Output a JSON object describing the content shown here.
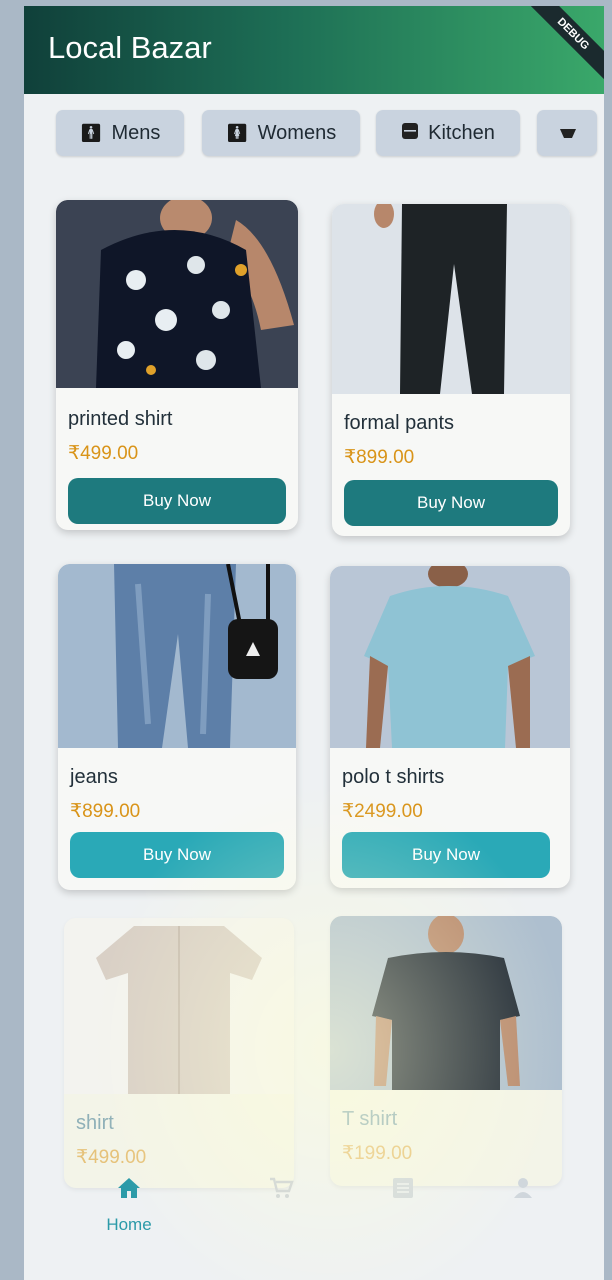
{
  "app": {
    "title": "Local Bazar",
    "debug_banner": "DEBUG"
  },
  "categories": [
    {
      "label": "Mens",
      "icon": "man-icon"
    },
    {
      "label": "Womens",
      "icon": "woman-icon"
    },
    {
      "label": "Kitchen",
      "icon": "kitchen-icon"
    },
    {
      "label": "",
      "icon": "category-icon"
    }
  ],
  "products": [
    {
      "name": "printed shirt",
      "price": "₹499.00",
      "button": "Buy Now"
    },
    {
      "name": "formal pants",
      "price": "₹899.00",
      "button": "Buy Now"
    },
    {
      "name": "jeans",
      "price": "₹899.00",
      "button": "Buy Now"
    },
    {
      "name": "polo t shirts",
      "price": "₹2499.00",
      "button": "Buy Now"
    },
    {
      "name": "shirt",
      "price": "₹499.00"
    },
    {
      "name": "T shirt",
      "price": "₹199.00"
    }
  ],
  "bottom_nav": [
    {
      "label": "Home",
      "icon": "home-icon",
      "active": true
    },
    {
      "label": "",
      "icon": "cart-icon"
    },
    {
      "label": "",
      "icon": "orders-icon"
    },
    {
      "label": "",
      "icon": "profile-icon"
    }
  ],
  "colors": {
    "appbar_start": "#10403a",
    "appbar_end": "#3aa86a",
    "button_teal": "#1e7a7e",
    "button_cyan": "#2aa9b7",
    "price": "#d99419"
  }
}
